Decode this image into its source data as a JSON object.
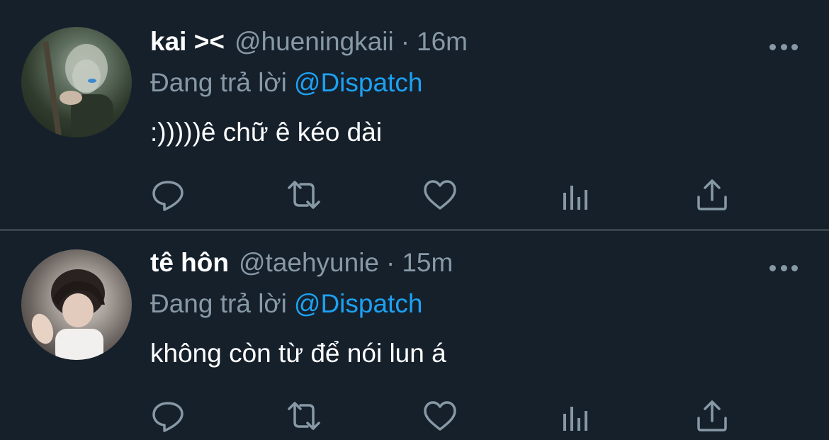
{
  "colors": {
    "background": "#15202b",
    "text_primary": "#ffffff",
    "text_secondary": "#8899a6",
    "accent": "#1da1f2",
    "divider": "#38444d"
  },
  "tweets": [
    {
      "display_name": "kai ><",
      "handle": "@hueningkaii",
      "separator": "·",
      "time": "16m",
      "replying_to_label": "Đang trả lời",
      "replying_to_handle": "@Dispatch",
      "text": ":)))))ê chữ ê kéo dài",
      "icons": [
        "reply-icon",
        "retweet-icon",
        "like-icon",
        "analytics-icon",
        "share-icon",
        "more-icon"
      ]
    },
    {
      "display_name": "tê hôn",
      "handle": "@taehyunie",
      "separator": "·",
      "time": "15m",
      "replying_to_label": "Đang trả lời",
      "replying_to_handle": "@Dispatch",
      "text": "không còn từ để nói lun á",
      "icons": [
        "reply-icon",
        "retweet-icon",
        "like-icon",
        "analytics-icon",
        "share-icon",
        "more-icon"
      ]
    }
  ]
}
